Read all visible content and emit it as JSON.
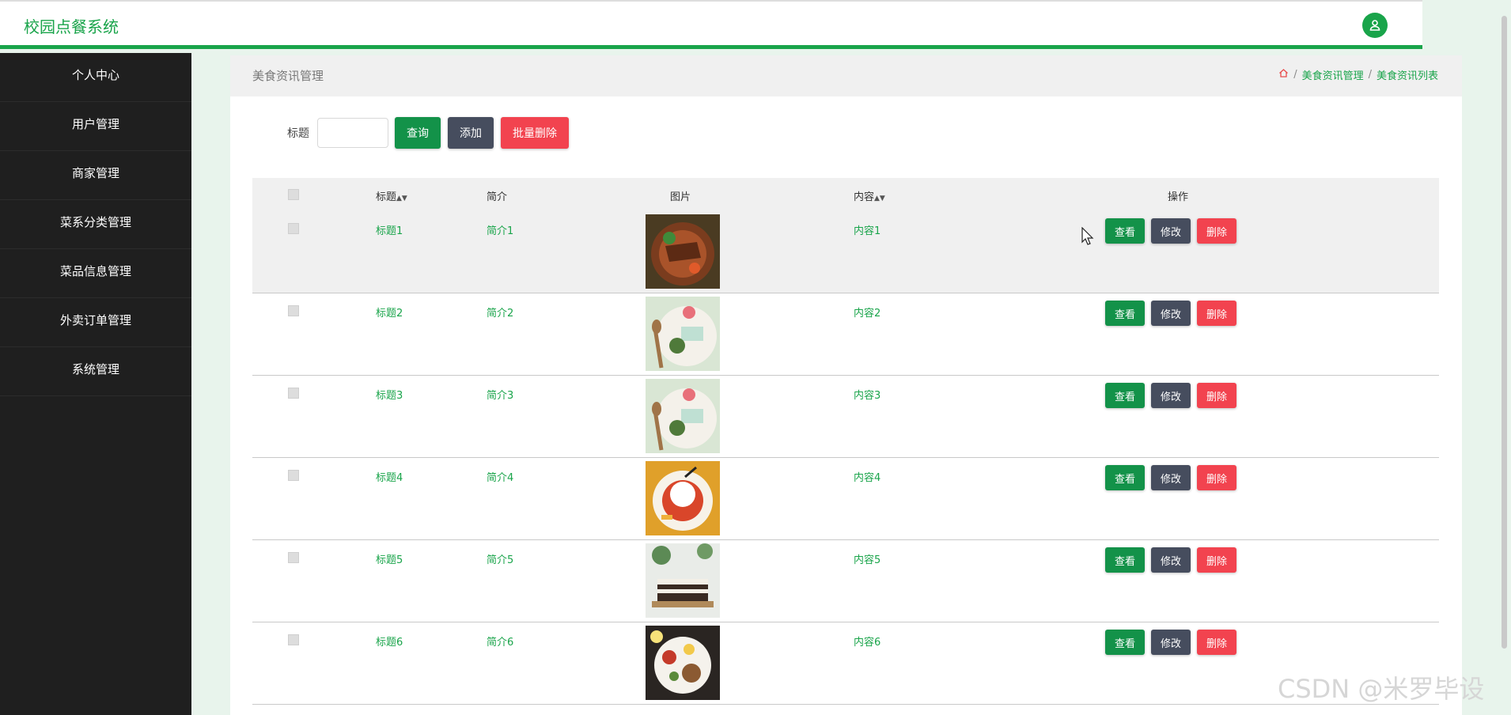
{
  "app": {
    "title": "校园点餐系统"
  },
  "sidebar": {
    "items": [
      {
        "label": "个人中心"
      },
      {
        "label": "用户管理"
      },
      {
        "label": "商家管理"
      },
      {
        "label": "菜系分类管理"
      },
      {
        "label": "菜品信息管理"
      },
      {
        "label": "外卖订单管理"
      },
      {
        "label": "系统管理"
      }
    ]
  },
  "page": {
    "title": "美食资讯管理",
    "breadcrumb": [
      "美食资讯管理",
      "美食资讯列表"
    ]
  },
  "search": {
    "label": "标题",
    "value": "",
    "query_button": "查询",
    "add_button": "添加",
    "batch_delete_button": "批量删除"
  },
  "table": {
    "headers": {
      "title": "标题",
      "intro": "简介",
      "image": "图片",
      "content": "内容",
      "ops": "操作"
    },
    "rows": [
      {
        "title": "标题1",
        "intro": "简介1",
        "content": "内容1",
        "image": "food-photo-1"
      },
      {
        "title": "标题2",
        "intro": "简介2",
        "content": "内容2",
        "image": "food-photo-2"
      },
      {
        "title": "标题3",
        "intro": "简介3",
        "content": "内容3",
        "image": "food-photo-3"
      },
      {
        "title": "标题4",
        "intro": "简介4",
        "content": "内容4",
        "image": "food-photo-4"
      },
      {
        "title": "标题5",
        "intro": "简介5",
        "content": "内容5",
        "image": "food-photo-5"
      },
      {
        "title": "标题6",
        "intro": "简介6",
        "content": "内容6",
        "image": "food-photo-6"
      }
    ],
    "actions": {
      "view": "查看",
      "edit": "修改",
      "delete": "删除"
    }
  },
  "watermark": "CSDN @米罗毕设",
  "colors": {
    "primary": "#19a44a",
    "dark_button": "#464d5e",
    "danger": "#f2434f",
    "sidebar": "#1f1f1f"
  }
}
